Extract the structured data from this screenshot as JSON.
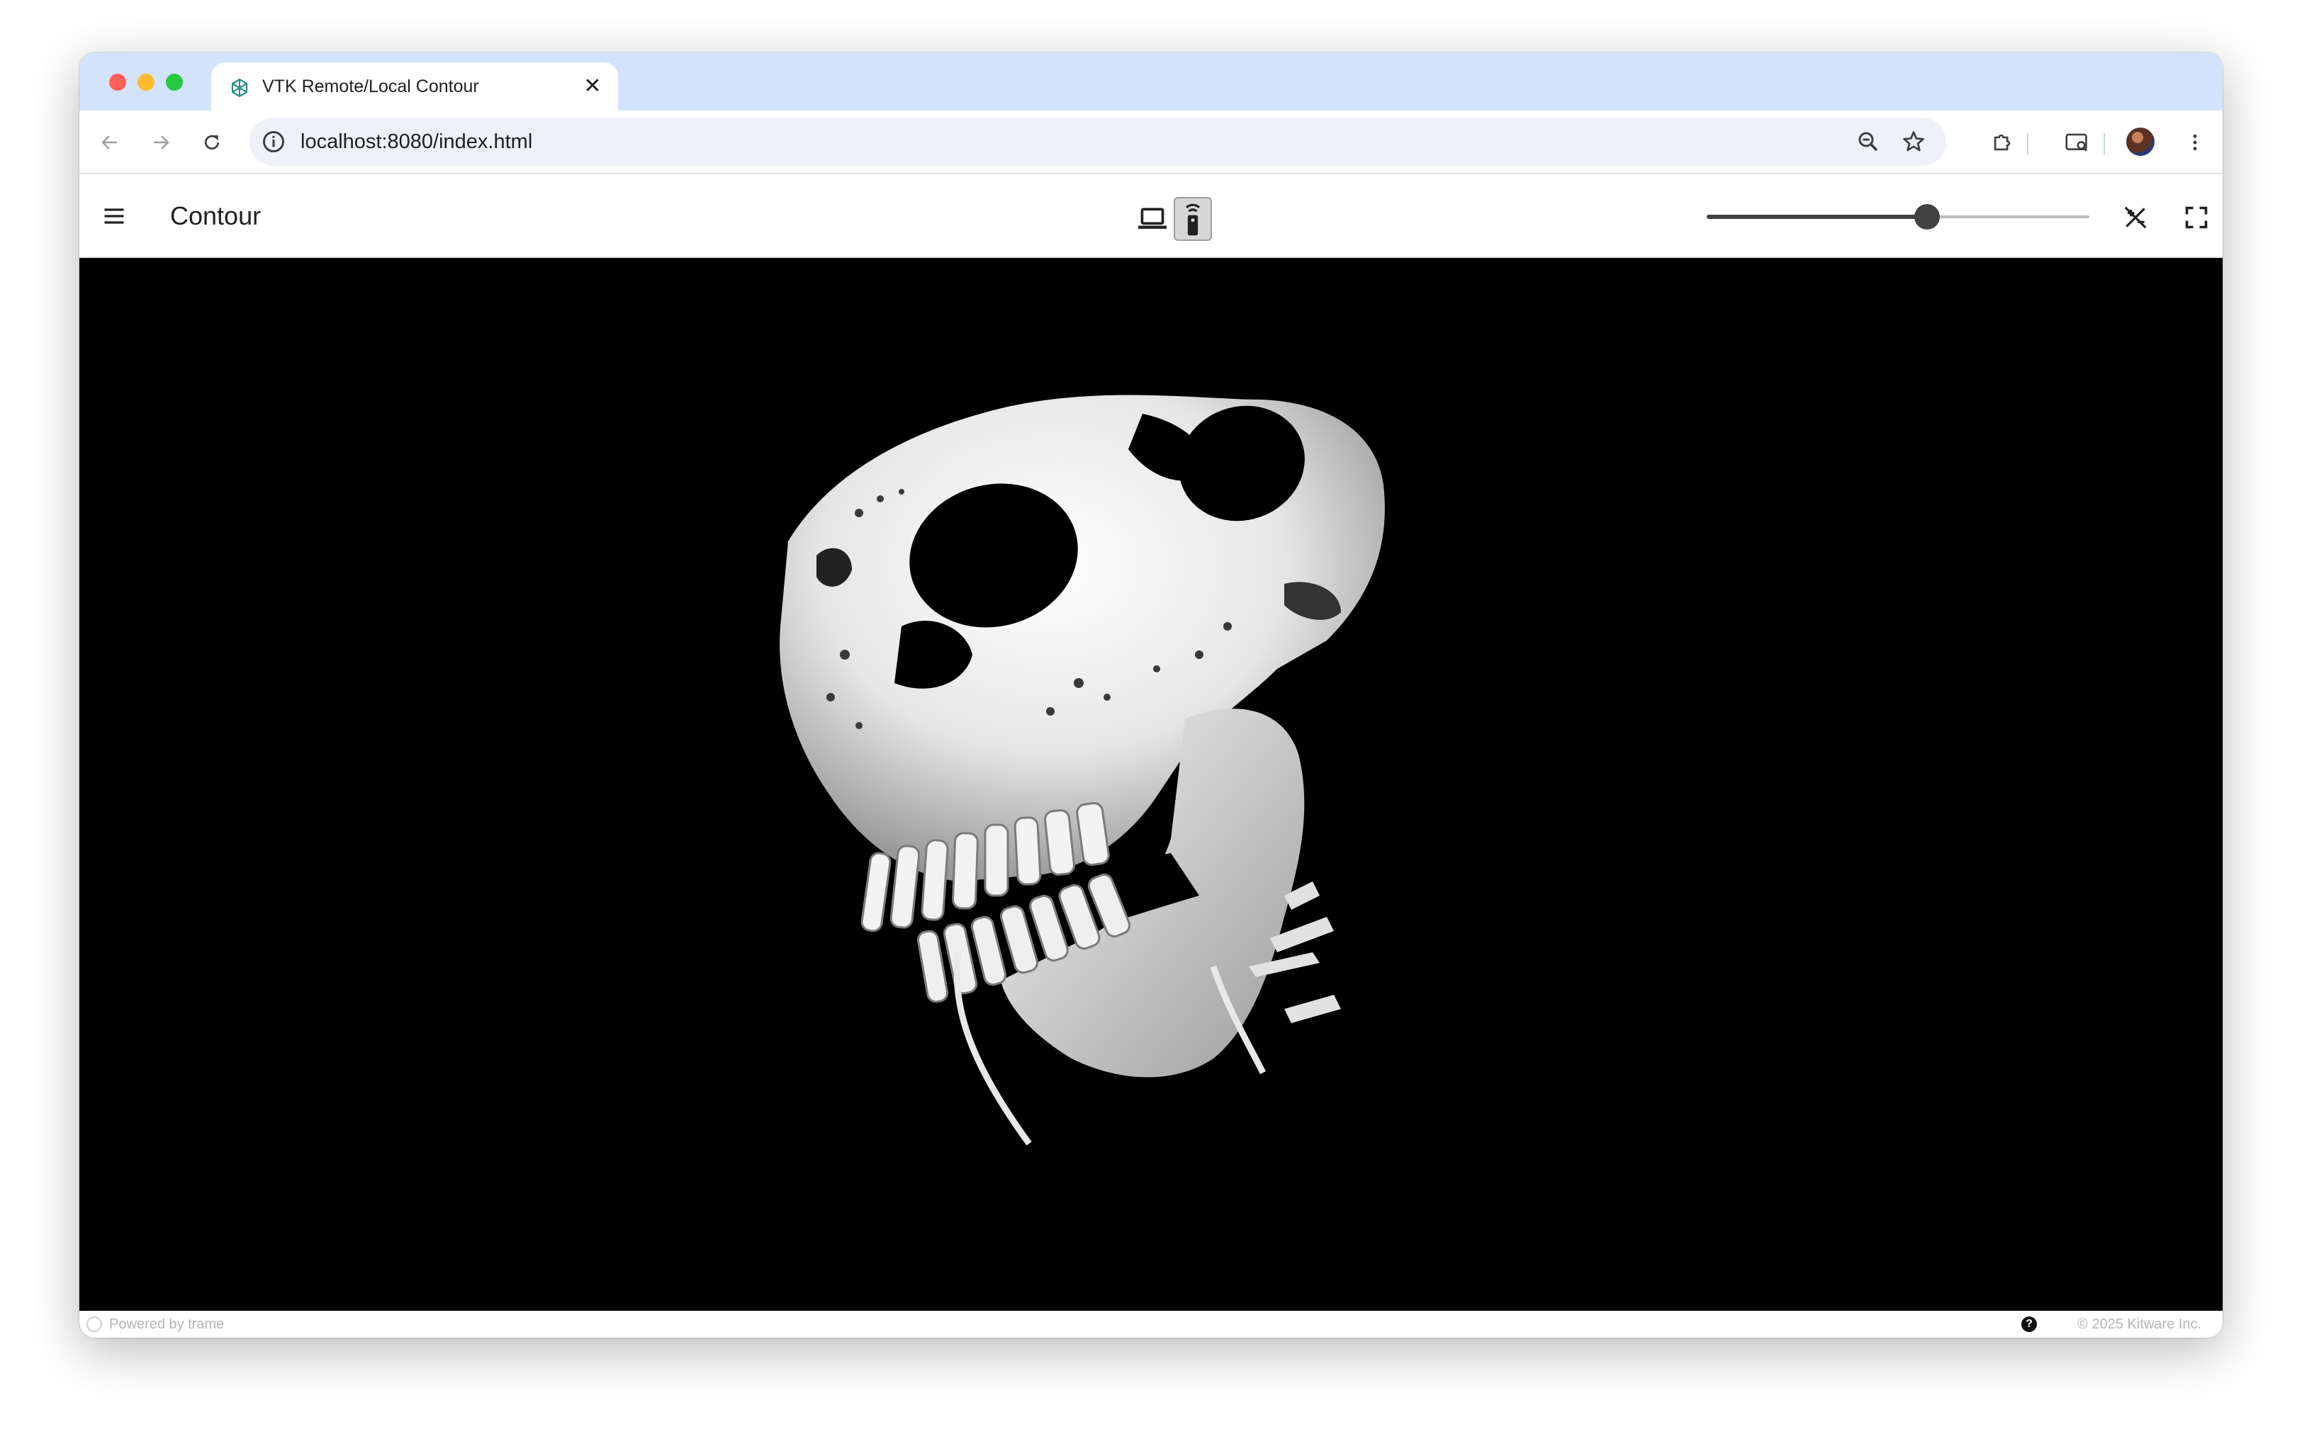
{
  "browser": {
    "tab_title": "VTK Remote/Local Contour",
    "tab_close_glyph": "✕",
    "new_tab_glyph": "+",
    "url": "localhost:8080/index.html"
  },
  "app": {
    "title": "Contour",
    "contour_slider": {
      "value": 0.575
    }
  },
  "footer": {
    "powered_by": "Powered by trame",
    "help_glyph": "?",
    "copyright": "© 2025 Kitware Inc."
  },
  "colors": {
    "tabstrip_bg": "#d3e3fd",
    "viewport_bg": "#000000",
    "slider_active": "#424242"
  }
}
